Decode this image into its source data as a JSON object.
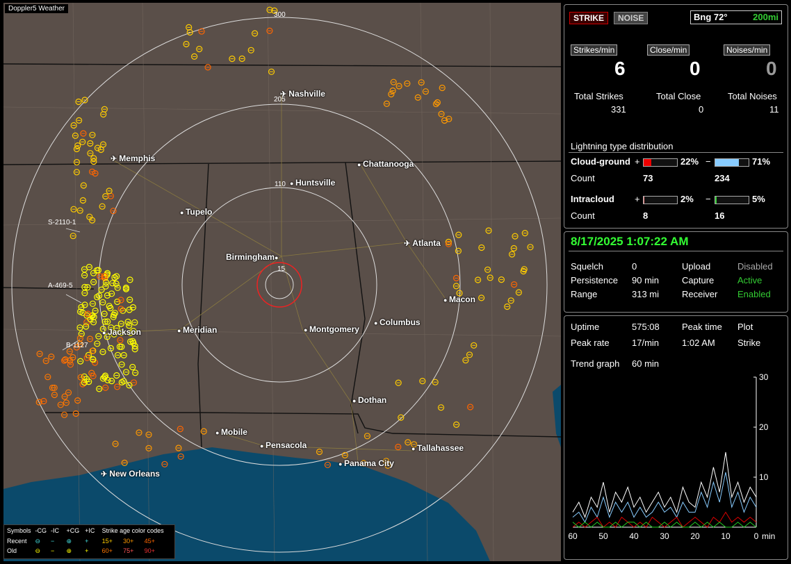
{
  "map": {
    "title": "Doppler5 Weather",
    "ring_labels": [
      "300",
      "205",
      "110",
      "15"
    ],
    "cities": [
      {
        "name": "Nashville",
        "airport": true
      },
      {
        "name": "Memphis",
        "airport": true
      },
      {
        "name": "Chattanooga",
        "airport": false
      },
      {
        "name": "Huntsville",
        "airport": false
      },
      {
        "name": "Tupelo",
        "airport": false
      },
      {
        "name": "Atlanta",
        "airport": true
      },
      {
        "name": "Birmingham",
        "airport": false
      },
      {
        "name": "Macon",
        "airport": false
      },
      {
        "name": "Meridian",
        "airport": false
      },
      {
        "name": "Jackson",
        "airport": false
      },
      {
        "name": "Montgomery",
        "airport": false
      },
      {
        "name": "Columbus",
        "airport": false
      },
      {
        "name": "Dothan",
        "airport": false
      },
      {
        "name": "Mobile",
        "airport": false
      },
      {
        "name": "Pensacola",
        "airport": false
      },
      {
        "name": "Tallahassee",
        "airport": false
      },
      {
        "name": "Panama City",
        "airport": false
      },
      {
        "name": "New Orleans",
        "airport": true
      }
    ],
    "storm_labels": [
      "S-2110-1",
      "A-469-5",
      "B-1127"
    ]
  },
  "legend": {
    "symbols_label": "Symbols",
    "col_cg_minus": "-CG",
    "col_ic_minus": "-IC",
    "col_cg_plus": "+CG",
    "col_ic_plus": "+IC",
    "age_title": "Strike age color codes",
    "recent_label": "Recent",
    "old_label": "Old",
    "ages_recent": [
      "15+",
      "30+",
      "45+"
    ],
    "ages_old": [
      "60+",
      "75+",
      "90+"
    ]
  },
  "status": {
    "strike_btn": "STRIKE",
    "noise_btn": "NOISE",
    "bearing": "Bng 72°",
    "range_btn": "200mi",
    "strikes_per_min_label": "Strikes/min",
    "close_per_min_label": "Close/min",
    "noises_per_min_label": "Noises/min",
    "strikes_per_min": "6",
    "close_per_min": "0",
    "noises_per_min": "0",
    "total_strikes_label": "Total Strikes",
    "total_close_label": "Total Close",
    "total_noises_label": "Total Noises",
    "total_strikes": "331",
    "total_close": "0",
    "total_noises": "11",
    "dist_title": "Lightning type distribution",
    "cg_label": "Cloud-ground",
    "ic_label": "Intracloud",
    "count_label": "Count",
    "plus": "+",
    "minus": "−",
    "cg_plus_pct": "22%",
    "cg_minus_pct": "71%",
    "cg_plus_count": "73",
    "cg_minus_count": "234",
    "ic_plus_pct": "2%",
    "ic_minus_pct": "5%",
    "ic_plus_count": "8",
    "ic_minus_count": "16",
    "cg_plus_frac": 0.22,
    "cg_minus_frac": 0.71,
    "ic_plus_frac": 0.02,
    "ic_minus_frac": 0.05
  },
  "settings": {
    "datetime": "8/17/2025 1:07:22 AM",
    "squelch_label": "Squelch",
    "squelch": "0",
    "upload_label": "Upload",
    "upload": "Disabled",
    "persistence_label": "Persistence",
    "persistence": "90 min",
    "capture_label": "Capture",
    "capture": "Active",
    "range_label": "Range",
    "range": "313 mi",
    "receiver_label": "Receiver",
    "receiver": "Enabled"
  },
  "stats": {
    "uptime_label": "Uptime",
    "uptime": "575:08",
    "peak_time_label": "Peak time",
    "peak_time": "1:02 AM",
    "plot_label": "Plot",
    "plot": "Strike",
    "peak_rate_label": "Peak rate",
    "peak_rate": "17/min",
    "trend_label": "Trend graph",
    "trend": "60 min"
  },
  "chart_data": {
    "type": "line",
    "xlabel": "min",
    "x_ticks": [
      "60",
      "50",
      "40",
      "30",
      "20",
      "10",
      "0"
    ],
    "y_ticks": [
      "10",
      "20",
      "30"
    ],
    "ylim": [
      0,
      30
    ],
    "x": [
      60,
      58,
      56,
      54,
      52,
      50,
      48,
      46,
      44,
      42,
      40,
      38,
      36,
      34,
      32,
      30,
      28,
      26,
      24,
      22,
      20,
      18,
      16,
      14,
      12,
      10,
      8,
      6,
      4,
      2,
      0
    ],
    "series": [
      {
        "color": "#ffffff",
        "values": [
          3,
          5,
          2,
          6,
          4,
          9,
          3,
          7,
          5,
          8,
          4,
          6,
          3,
          5,
          7,
          4,
          6,
          3,
          8,
          5,
          4,
          9,
          6,
          12,
          7,
          15,
          6,
          9,
          5,
          8,
          6
        ]
      },
      {
        "color": "#88ccff",
        "values": [
          2,
          3,
          1,
          4,
          2,
          6,
          2,
          5,
          3,
          5,
          2,
          4,
          2,
          3,
          5,
          3,
          4,
          2,
          5,
          3,
          3,
          7,
          4,
          9,
          5,
          11,
          4,
          7,
          3,
          6,
          4
        ]
      },
      {
        "color": "#dd0000",
        "values": [
          0,
          1,
          0,
          1,
          2,
          0,
          1,
          0,
          2,
          1,
          0,
          1,
          0,
          2,
          1,
          0,
          1,
          2,
          0,
          1,
          2,
          1,
          0,
          2,
          1,
          3,
          1,
          2,
          1,
          2,
          1
        ]
      },
      {
        "color": "#22cc22",
        "values": [
          1,
          0,
          1,
          0,
          1,
          0,
          0,
          1,
          0,
          1,
          1,
          0,
          1,
          0,
          0,
          1,
          0,
          1,
          0,
          0,
          1,
          0,
          1,
          0,
          1,
          0,
          0,
          1,
          0,
          1,
          0
        ]
      }
    ]
  }
}
